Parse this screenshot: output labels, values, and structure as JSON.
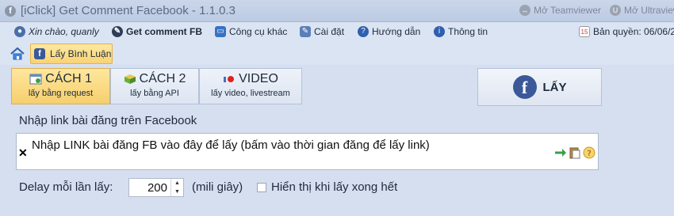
{
  "window": {
    "title": "[iClick] Get Comment Facebook - 1.1.0.3",
    "app_icon": "facebook-icon",
    "teamviewer_label": "Mở Teamviewer",
    "ultraviewer_label": "Mở Ultraview"
  },
  "menu": {
    "greeting": "Xin chào, quanly",
    "get_comment": "Get comment FB",
    "tools": "Công cụ khác",
    "settings": "Cài đặt",
    "guide": "Hướng dẫn",
    "info": "Thông tin",
    "license": "Bản quyền: 06/06/2"
  },
  "ribbon": {
    "active_tab": "Lấy Bình Luận"
  },
  "methods": [
    {
      "title": "CÁCH 1",
      "subtitle": "lấy bằng request",
      "icon": "browser-icon",
      "active": true
    },
    {
      "title": "CÁCH 2",
      "subtitle": "lấy bằng API",
      "icon": "cube-icon",
      "active": false
    },
    {
      "title": "VIDEO",
      "subtitle": "lấy video, livestream",
      "icon": "record-icon",
      "active": false
    }
  ],
  "fetch_button": {
    "label": "LẤY",
    "icon": "facebook-icon"
  },
  "link_section": {
    "label": "Nhập link bài đăng trên Facebook",
    "value": "Nhập LINK bài đăng FB vào đây để lấy (bấm vào thời gian đăng để lấy link)"
  },
  "delay": {
    "label": "Delay mỗi lần lấy:",
    "value": "200",
    "unit": "(mili giây)",
    "show_when_done_label": "Hiển thị khi lấy xong hết",
    "show_when_done_checked": false
  },
  "colors": {
    "background": "#d6dff0",
    "active_tab": "#f9d273",
    "facebook_blue": "#3b5998"
  }
}
